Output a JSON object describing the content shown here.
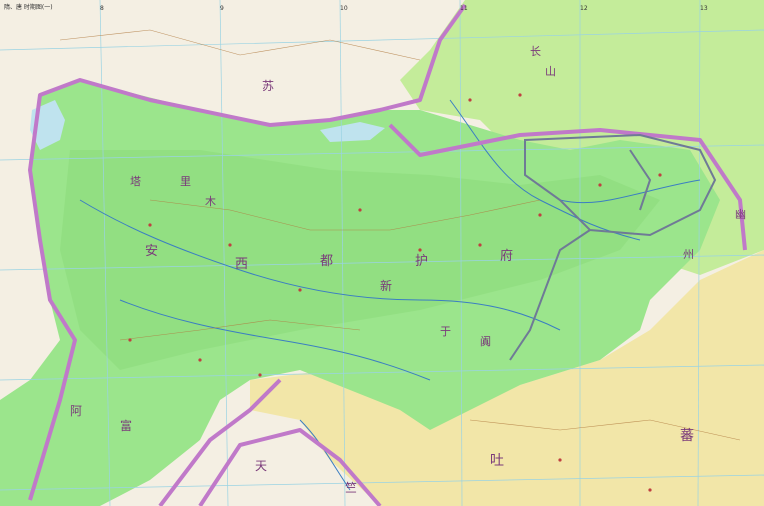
{
  "header": {
    "title": "隋、唐 时期图(一)"
  },
  "colors": {
    "tang_region": "#9be58c",
    "tang_region_dark": "#7fd36e",
    "northeast_region": "#c4ec9a",
    "tibet_region": "#f2e6a8",
    "outer_land": "#f4efe3",
    "sea": "#bfe3ee",
    "purple_border": "#c079c9",
    "gray_border": "#6f7a96",
    "grid": "#9ad3e3",
    "river": "#3b7ec2"
  },
  "region_labels": [
    {
      "id": "su",
      "text": "苏"
    },
    {
      "id": "an",
      "text": "安"
    },
    {
      "id": "xi",
      "text": "西"
    },
    {
      "id": "du",
      "text": "都"
    },
    {
      "id": "hu",
      "text": "护"
    },
    {
      "id": "fu",
      "text": "府"
    },
    {
      "id": "xin",
      "text": "新"
    },
    {
      "id": "tu",
      "text": "吐"
    },
    {
      "id": "bo",
      "text": "蕃"
    },
    {
      "id": "a",
      "text": "阿"
    },
    {
      "id": "fu2",
      "text": "富"
    },
    {
      "id": "tian",
      "text": "天"
    },
    {
      "id": "zhu",
      "text": "竺"
    },
    {
      "id": "you",
      "text": "幽"
    },
    {
      "id": "zhou",
      "text": "州"
    },
    {
      "id": "chang",
      "text": "长"
    },
    {
      "id": "shan",
      "text": "山"
    },
    {
      "id": "ta",
      "text": "塔"
    },
    {
      "id": "li",
      "text": "里"
    },
    {
      "id": "mu",
      "text": "木"
    },
    {
      "id": "yu",
      "text": "于"
    },
    {
      "id": "tian2",
      "text": "阗"
    }
  ],
  "grid_numbers": [
    "8",
    "9",
    "10",
    "11",
    "12",
    "13"
  ]
}
